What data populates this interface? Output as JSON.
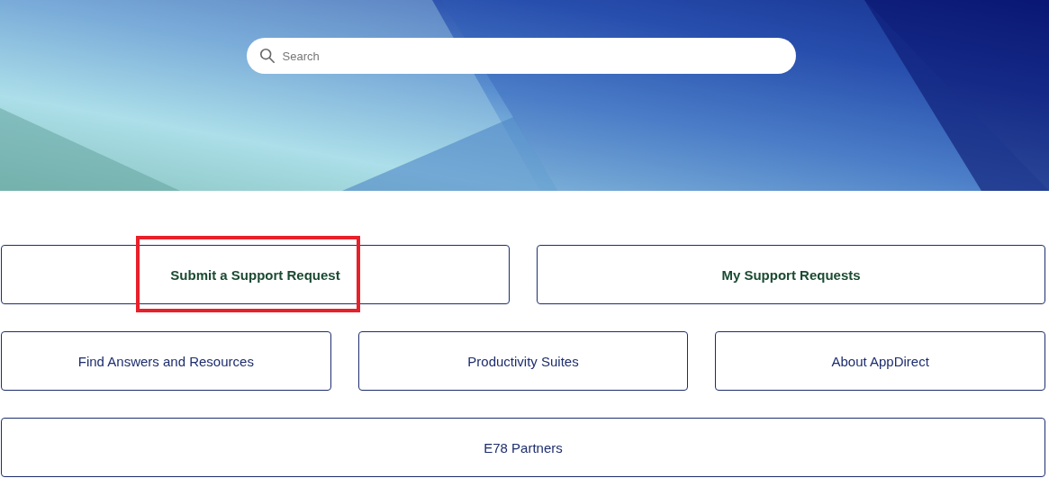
{
  "search": {
    "placeholder": "Search"
  },
  "tile_rows": [
    [
      {
        "label": "Submit a Support Request",
        "kind": "primary",
        "highlighted": true
      },
      {
        "label": "My Support Requests",
        "kind": "primary",
        "highlighted": false
      }
    ],
    [
      {
        "label": "Find Answers and Resources",
        "kind": "secondary",
        "highlighted": false
      },
      {
        "label": "Productivity Suites",
        "kind": "secondary",
        "highlighted": false
      },
      {
        "label": "About AppDirect",
        "kind": "secondary",
        "highlighted": false
      }
    ],
    [
      {
        "label": "E78 Partners",
        "kind": "secondary",
        "highlighted": false
      }
    ]
  ]
}
